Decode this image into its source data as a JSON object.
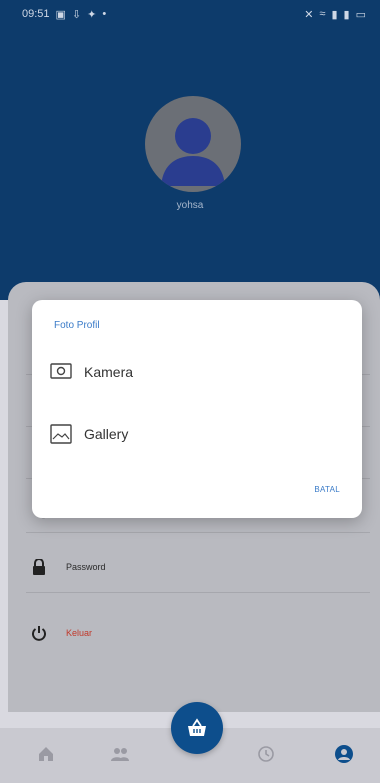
{
  "status_bar": {
    "time": "09:51"
  },
  "profile": {
    "username": "yohsa"
  },
  "menu": {
    "items": [
      {
        "label": "",
        "icon": "person-icon"
      },
      {
        "label": "",
        "icon": "card-icon"
      },
      {
        "label": "",
        "icon": "person-icon"
      },
      {
        "label": "",
        "icon": "phone-icon"
      },
      {
        "label": "Password",
        "icon": "lock-icon"
      },
      {
        "label": "Keluar",
        "icon": "power-icon",
        "color": "#c0392b"
      }
    ]
  },
  "dialog": {
    "title": "Foto Profil",
    "options": [
      {
        "label": "Kamera",
        "icon": "camera-icon"
      },
      {
        "label": "Gallery",
        "icon": "gallery-icon"
      }
    ],
    "cancel_label": "BATAL"
  },
  "bottom_nav": {
    "items": [
      "home-icon",
      "people-icon",
      "basket-icon",
      "history-icon",
      "account-icon"
    ],
    "active": "account-icon"
  },
  "colors": {
    "header": "#0d3b6b",
    "accent": "#3a7bc8",
    "fab": "#0d4e8c"
  }
}
